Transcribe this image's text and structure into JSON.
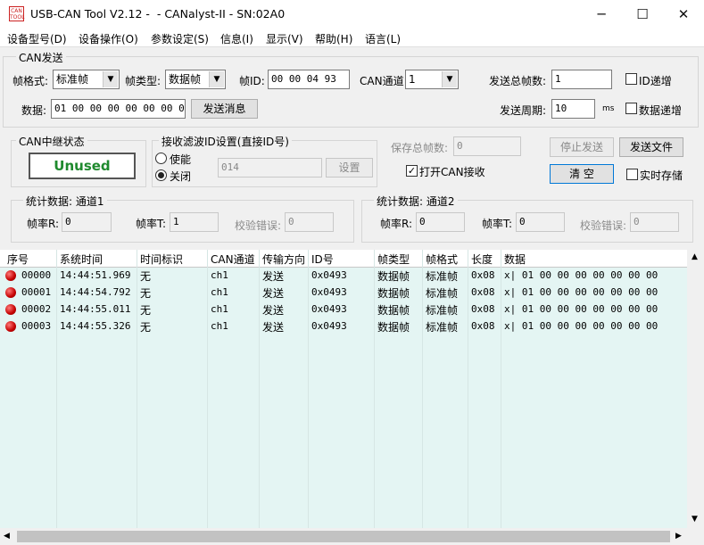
{
  "window": {
    "title": "USB-CAN Tool V2.12 -  - CANalyst-II - SN:02A0",
    "icon_text": "CAN\nTOOL",
    "minimize": "─",
    "maximize": "☐",
    "close": "✕"
  },
  "menu": [
    "设备型号(D)",
    "设备操作(O)",
    "参数设定(S)",
    "信息(I)",
    "显示(V)",
    "帮助(H)",
    "语言(L)"
  ],
  "can_send": {
    "group_title": "CAN发送",
    "frame_format_label": "帧格式:",
    "frame_format_value": "标准帧",
    "frame_type_label": "帧类型:",
    "frame_type_value": "数据帧",
    "frame_id_label": "帧ID:",
    "frame_id_value": "00 00 04 93",
    "channel_label": "CAN通道:",
    "channel_value": "1",
    "total_frames_label": "发送总帧数:",
    "total_frames_value": "1",
    "id_increment_label": "ID递增",
    "data_label": "数据:",
    "data_value": "01 00 00 00 00 00 00 00",
    "send_button": "发送消息",
    "period_label": "发送周期:",
    "period_value": "10",
    "period_unit": "ms",
    "data_increment_label": "数据递增"
  },
  "relay": {
    "title": "CAN中继状态",
    "status": "Unused"
  },
  "filter": {
    "title": "接收滤波ID设置(直接ID号)",
    "enable_label": "使能",
    "disable_label": "关闭",
    "id_value": "014",
    "set_button": "设置"
  },
  "save": {
    "total_label": "保存总帧数:",
    "total_value": "0",
    "open_receive_label": "打开CAN接收",
    "stop_send_button": "停止发送",
    "send_file_button": "发送文件",
    "clear_button": "清 空",
    "realtime_save_label": "实时存储"
  },
  "stats1": {
    "title": "统计数据: 通道1",
    "rx_label": "帧率R:",
    "rx_value": "0",
    "tx_label": "帧率T:",
    "tx_value": "1",
    "err_label": "校验错误:",
    "err_value": "0"
  },
  "stats2": {
    "title": "统计数据: 通道2",
    "rx_label": "帧率R:",
    "rx_value": "0",
    "tx_label": "帧率T:",
    "tx_value": "0",
    "err_label": "校验错误:",
    "err_value": "0"
  },
  "table": {
    "columns": [
      "序号",
      "系统时间",
      "时间标识",
      "CAN通道",
      "传输方向",
      "ID号",
      "帧类型",
      "帧格式",
      "长度",
      "数据"
    ],
    "rows": [
      [
        "00000",
        "14:44:51.969",
        "无",
        "ch1",
        "发送",
        "0x0493",
        "数据帧",
        "标准帧",
        "0x08",
        "x| 01 00 00 00 00 00 00 00"
      ],
      [
        "00001",
        "14:44:54.792",
        "无",
        "ch1",
        "发送",
        "0x0493",
        "数据帧",
        "标准帧",
        "0x08",
        "x| 01 00 00 00 00 00 00 00"
      ],
      [
        "00002",
        "14:44:55.011",
        "无",
        "ch1",
        "发送",
        "0x0493",
        "数据帧",
        "标准帧",
        "0x08",
        "x| 01 00 00 00 00 00 00 00"
      ],
      [
        "00003",
        "14:44:55.326",
        "无",
        "ch1",
        "发送",
        "0x0493",
        "数据帧",
        "标准帧",
        "0x08",
        "x| 01 00 00 00 00 00 00 00"
      ]
    ]
  },
  "colors": {
    "status_green": "#1f8a2e",
    "row_dot": "#c40000",
    "grid_bg": "#e4f5f3"
  }
}
